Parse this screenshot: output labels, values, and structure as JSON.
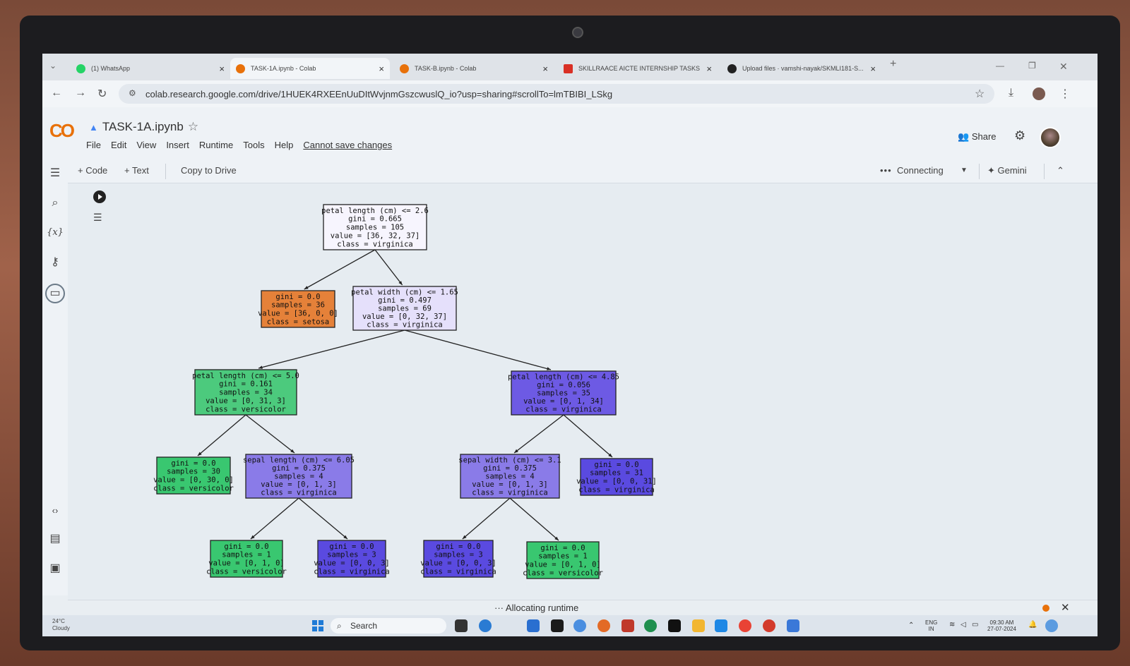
{
  "browser": {
    "tabs": [
      {
        "title": "(1) WhatsApp",
        "icon": "whatsapp-icon",
        "color": "#25d366"
      },
      {
        "title": "TASK-1A.ipynb - Colab",
        "icon": "colab-icon",
        "color": "#e8710a"
      },
      {
        "title": "TASK-B.ipynb - Colab",
        "icon": "colab-icon",
        "color": "#e8710a"
      },
      {
        "title": "SKILLRAACE AICTE INTERNSHIP TASKS",
        "icon": "gmail-icon",
        "color": "#d93025"
      },
      {
        "title": "Upload files · vamshi-nayak/SKMLI181-S...",
        "icon": "github-icon",
        "color": "#222222"
      }
    ],
    "url": "colab.research.google.com/drive/1HUEK4RXEEnUuDItWvjnmGszcwuslQ_io?usp=sharing#scrollTo=lmTBIBI_LSkg"
  },
  "colab": {
    "title": "TASK-1A.ipynb",
    "menu": [
      "File",
      "Edit",
      "View",
      "Insert",
      "Runtime",
      "Tools",
      "Help"
    ],
    "save_warning": "Cannot save changes",
    "share_label": "Share",
    "toolbar": {
      "code": "+ Code",
      "text": "+ Text",
      "copy": "Copy to Drive",
      "connecting": "Connecting",
      "gemini": "✦ Gemini"
    },
    "status": "Allocating runtime"
  },
  "tree": {
    "colors": {
      "setosa": "#e58139",
      "versicolor": "#39c770",
      "virginica": "#8f7ce8"
    },
    "nodes": [
      {
        "id": "n0",
        "lines": [
          "petal length (cm) <= 2.6",
          "gini = 0.665",
          "samples = 105",
          "value = [36, 32, 37]",
          "class = virginica"
        ],
        "fill": "#f7f5fe"
      },
      {
        "id": "n1",
        "lines": [
          "gini = 0.0",
          "samples = 36",
          "value = [36, 0, 0]",
          "class = setosa"
        ],
        "fill": "#e58139"
      },
      {
        "id": "n2",
        "lines": [
          "petal width (cm) <= 1.65",
          "gini = 0.497",
          "samples = 69",
          "value = [0, 32, 37]",
          "class = virginica"
        ],
        "fill": "#e5e0fb"
      },
      {
        "id": "n3",
        "lines": [
          "petal length (cm) <= 5.0",
          "gini = 0.161",
          "samples = 34",
          "value = [0, 31, 3]",
          "class = versicolor"
        ],
        "fill": "#4cca7d"
      },
      {
        "id": "n4",
        "lines": [
          "petal length (cm) <= 4.85",
          "gini = 0.056",
          "samples = 35",
          "value = [0, 1, 34]",
          "class = virginica"
        ],
        "fill": "#6d5ae4"
      },
      {
        "id": "n5",
        "lines": [
          "gini = 0.0",
          "samples = 30",
          "value = [0, 30, 0]",
          "class = versicolor"
        ],
        "fill": "#39c770"
      },
      {
        "id": "n6",
        "lines": [
          "sepal length (cm) <= 6.05",
          "gini = 0.375",
          "samples = 4",
          "value = [0, 1, 3]",
          "class = virginica"
        ],
        "fill": "#8a7be8"
      },
      {
        "id": "n7",
        "lines": [
          "sepal width (cm) <= 3.1",
          "gini = 0.375",
          "samples = 4",
          "value = [0, 1, 3]",
          "class = virginica"
        ],
        "fill": "#8a7be8"
      },
      {
        "id": "n8",
        "lines": [
          "gini = 0.0",
          "samples = 31",
          "value = [0, 0, 31]",
          "class = virginica"
        ],
        "fill": "#5a4ae0"
      },
      {
        "id": "n9",
        "lines": [
          "gini = 0.0",
          "samples = 1",
          "value = [0, 1, 0]",
          "class = versicolor"
        ],
        "fill": "#39c770"
      },
      {
        "id": "n10",
        "lines": [
          "gini = 0.0",
          "samples = 3",
          "value = [0, 0, 3]",
          "class = virginica"
        ],
        "fill": "#5a4ae0"
      },
      {
        "id": "n11",
        "lines": [
          "gini = 0.0",
          "samples = 3",
          "value = [0, 0, 3]",
          "class = virginica"
        ],
        "fill": "#5a4ae0"
      },
      {
        "id": "n12",
        "lines": [
          "gini = 0.0",
          "samples = 1",
          "value = [0, 1, 0]",
          "class = versicolor"
        ],
        "fill": "#39c770"
      }
    ],
    "edges": [
      [
        "n0",
        "n1"
      ],
      [
        "n0",
        "n2"
      ],
      [
        "n2",
        "n3"
      ],
      [
        "n2",
        "n4"
      ],
      [
        "n3",
        "n5"
      ],
      [
        "n3",
        "n6"
      ],
      [
        "n4",
        "n7"
      ],
      [
        "n4",
        "n8"
      ],
      [
        "n6",
        "n9"
      ],
      [
        "n6",
        "n10"
      ],
      [
        "n7",
        "n11"
      ],
      [
        "n7",
        "n12"
      ]
    ]
  },
  "taskbar": {
    "weather_temp": "24°C",
    "weather_desc": "Cloudy",
    "search": "Search",
    "lang": "ENG",
    "region": "IN",
    "time": "09:30 AM",
    "date": "27-07-2024"
  }
}
